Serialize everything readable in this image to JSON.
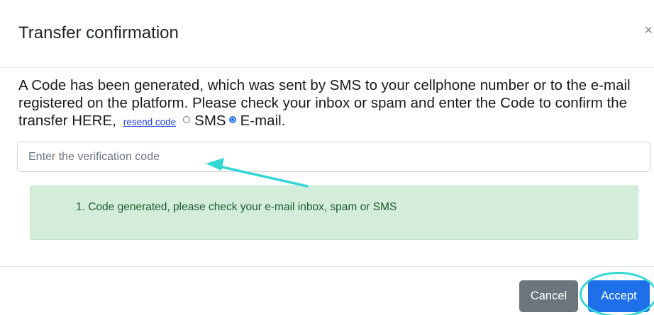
{
  "modal": {
    "title": "Transfer confirmation",
    "close_symbol": "×"
  },
  "message": {
    "text": "A Code has been generated, which was sent by SMS to your cellphone number or to the e-mail registered on the platform. Please check your inbox or spam and enter the Code to confirm the transfer HERE,",
    "resend_label": "resend code",
    "options": [
      {
        "label": "SMS",
        "checked": false
      },
      {
        "label": "E-mail.",
        "checked": true
      }
    ]
  },
  "code_input": {
    "placeholder": "Enter the verification code",
    "value": ""
  },
  "alert": {
    "text": "1. Code generated, please check your e-mail inbox, spam or SMS"
  },
  "footer": {
    "cancel_label": "Cancel",
    "accept_label": "Accept"
  },
  "colors": {
    "primary": "#1f6feb",
    "secondary": "#6c757d",
    "success_bg": "#d4edda",
    "success_text": "#1e5b2d",
    "annotation": "#34d6d6"
  },
  "icons": {
    "close": "close-icon",
    "arrow": "arrow-annotation",
    "ring": "highlight-ring"
  }
}
